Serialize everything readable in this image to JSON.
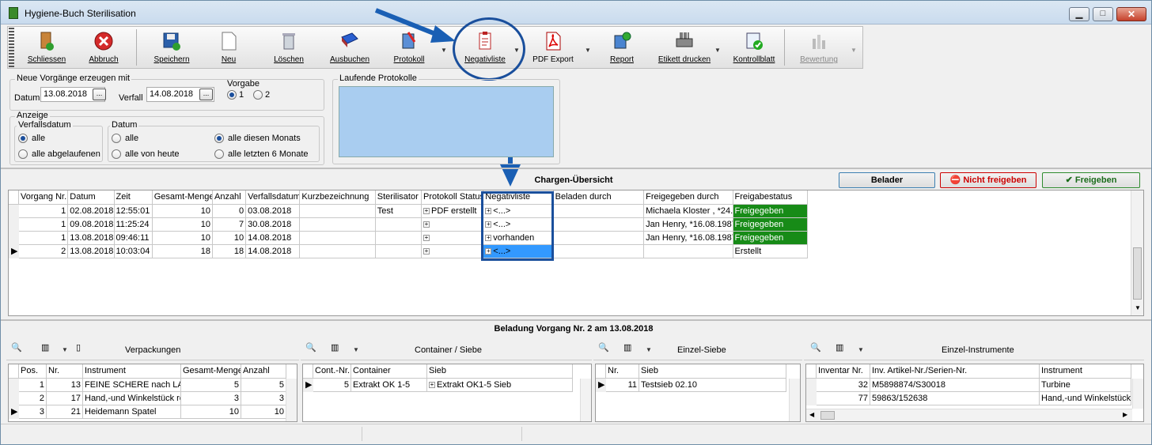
{
  "window": {
    "title": "Hygiene-Buch Sterilisation",
    "min": "▁",
    "max": "□",
    "close": "✕"
  },
  "toolbar": [
    {
      "label": "Schliessen",
      "icon": "door-exit-icon"
    },
    {
      "label": "Abbruch",
      "icon": "cancel-icon"
    },
    {
      "label": "Speichern",
      "icon": "save-icon"
    },
    {
      "label": "Neu",
      "icon": "new-document-icon"
    },
    {
      "label": "Löschen",
      "icon": "trash-icon"
    },
    {
      "label": "Ausbuchen",
      "icon": "book-icon"
    },
    {
      "label": "Protokoll",
      "icon": "protocol-icon"
    },
    {
      "label": "Negativliste",
      "icon": "clipboard-icon"
    },
    {
      "label": "PDF Export",
      "icon": "pdf-icon"
    },
    {
      "label": "Report",
      "icon": "report-icon"
    },
    {
      "label": "Etikett drucken",
      "icon": "label-printer-icon"
    },
    {
      "label": "Kontrollblatt",
      "icon": "checklist-icon"
    },
    {
      "label": "Bewertung",
      "icon": "rating-icon"
    }
  ],
  "form": {
    "neue_title": "Neue Vorgänge erzeugen mit",
    "datum_label": "Datum",
    "datum_value": "13.08.2018",
    "verfall_label": "Verfall",
    "verfall_value": "14.08.2018",
    "vorgabe_title": "Vorgabe",
    "vorgabe_opt1": "1",
    "vorgabe_opt2": "2",
    "anzeige_title": "Anzeige",
    "verfallsdatum_title": "Verfallsdatum",
    "vd_opt1": "alle",
    "vd_opt2": "alle abgelaufenen",
    "datum_group_title": "Datum",
    "d_opt1": "alle",
    "d_opt2": "alle von heute",
    "d_opt3": "alle diesen Monats",
    "d_opt4": "alle letzten 6 Monate",
    "laufende_title": "Laufende Protokolle",
    "dots": "..."
  },
  "chargen": {
    "title": "Chargen-Übersicht",
    "btn_belader": "Belader",
    "btn_nicht": "Nicht freigeben",
    "btn_frei": "Freigeben",
    "columns": [
      "Vorgang Nr.",
      "Datum",
      "Zeit",
      "Gesamt-Menge",
      "Anzahl",
      "Verfallsdatum",
      "Kurzbezeichnung",
      "Sterilisator",
      "Protokoll Status",
      "Negativliste",
      "Beladen durch",
      "Freigegeben durch",
      "Freigabestatus"
    ],
    "rows": [
      [
        "1",
        "02.08.2018",
        "12:55:01",
        "10",
        "0",
        "03.08.2018",
        "",
        "Test",
        "PDF erstellt",
        "<...>",
        "",
        "Michaela  Kloster , *24.",
        "Freigegeben"
      ],
      [
        "1",
        "09.08.2018",
        "11:25:24",
        "10",
        "7",
        "30.08.2018",
        "",
        "",
        "",
        "<...>",
        "",
        "Jan Henry, *16.08.1987",
        "Freigegeben"
      ],
      [
        "1",
        "13.08.2018",
        "09:46:11",
        "10",
        "10",
        "14.08.2018",
        "",
        "",
        "",
        "vorhanden",
        "",
        "Jan Henry, *16.08.1987",
        "Freigegeben"
      ],
      [
        "2",
        "13.08.2018",
        "10:03:04",
        "18",
        "18",
        "14.08.2018",
        "",
        "",
        "",
        "<...>",
        "",
        "",
        "Erstellt"
      ]
    ]
  },
  "beladung": {
    "title": "Beladung Vorgang Nr. 2 am 13.08.2018"
  },
  "verpackungen": {
    "title": "Verpackungen",
    "columns": [
      "Pos.",
      "Nr.",
      "Instrument",
      "Gesamt-Menge",
      "Anzahl"
    ],
    "rows": [
      [
        "1",
        "13",
        "FEINE SCHERE nach LA",
        "5",
        "5"
      ],
      [
        "2",
        "17",
        "Hand,-und Winkelstück ro",
        "3",
        "3"
      ],
      [
        "3",
        "21",
        "Heidemann Spatel",
        "10",
        "10"
      ]
    ]
  },
  "container": {
    "title": "Container / Siebe",
    "columns": [
      "Cont.-Nr.",
      "Container",
      "Sieb"
    ],
    "rows": [
      [
        "5",
        "Extrakt OK 1-5",
        "Extrakt OK1-5 Sieb"
      ]
    ]
  },
  "einzelsiebe": {
    "title": "Einzel-Siebe",
    "columns": [
      "Nr.",
      "Sieb"
    ],
    "rows": [
      [
        "11",
        "Testsieb 02.10"
      ]
    ]
  },
  "einzelinstrumente": {
    "title": "Einzel-Instrumente",
    "columns": [
      "Inventar Nr.",
      "Inv. Artikel-Nr./Serien-Nr.",
      "Instrument"
    ],
    "rows": [
      [
        "32",
        "M5898874/S30018",
        "Turbine"
      ],
      [
        "77",
        "59863/152638",
        "Hand,-und Winkelstück"
      ]
    ]
  },
  "colors": {
    "accent": "#1a5fb4",
    "freigegeben": "#178b17",
    "selected": "#3399ff"
  }
}
